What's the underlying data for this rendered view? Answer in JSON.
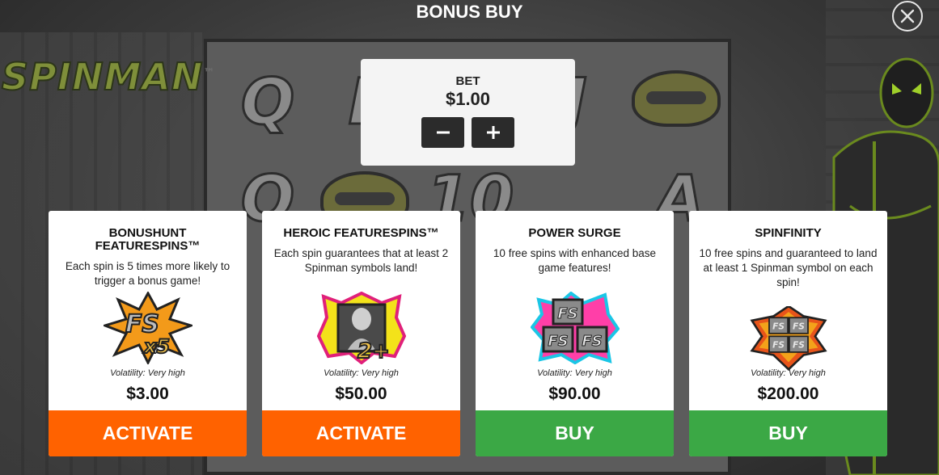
{
  "game": {
    "logo_text": "SPINMAN",
    "logo_tm": "™"
  },
  "header": {
    "title": "BONUS BUY"
  },
  "bet": {
    "label": "BET",
    "value": "$1.00",
    "decrease_icon": "minus-icon",
    "increase_icon": "plus-icon"
  },
  "cards": [
    {
      "title": "BONUSHUNT FEATURESPINS™",
      "description": "Each spin is 5 times more likely to trigger a bonus game!",
      "icon": "fs-x5-icon",
      "volatility": "Volatility: Very high",
      "price": "$3.00",
      "action": "ACTIVATE",
      "action_color": "#ff6200"
    },
    {
      "title": "HEROIC FEATURESPINS™",
      "description": "Each spin guarantees that at least 2 Spinman symbols land!",
      "icon": "spinman-2plus-icon",
      "volatility": "Volatility: Very high",
      "price": "$50.00",
      "action": "ACTIVATE",
      "action_color": "#ff6200"
    },
    {
      "title": "POWER SURGE",
      "description": "10 free spins with enhanced base game features!",
      "icon": "fs-triple-icon",
      "volatility": "Volatility: Very high",
      "price": "$90.00",
      "action": "BUY",
      "action_color": "#3ba845"
    },
    {
      "title": "SPINFINITY",
      "description": "10 free spins and guaranteed to land at least 1 Spinman symbol on each spin!",
      "icon": "fs-quad-icon",
      "volatility": "Volatility: Very high",
      "price": "$200.00",
      "action": "BUY",
      "action_color": "#3ba845"
    }
  ],
  "colors": {
    "activate": "#ff6200",
    "buy": "#3ba845",
    "card_bg": "#ffffff",
    "bet_button": "#2b2b2b"
  }
}
